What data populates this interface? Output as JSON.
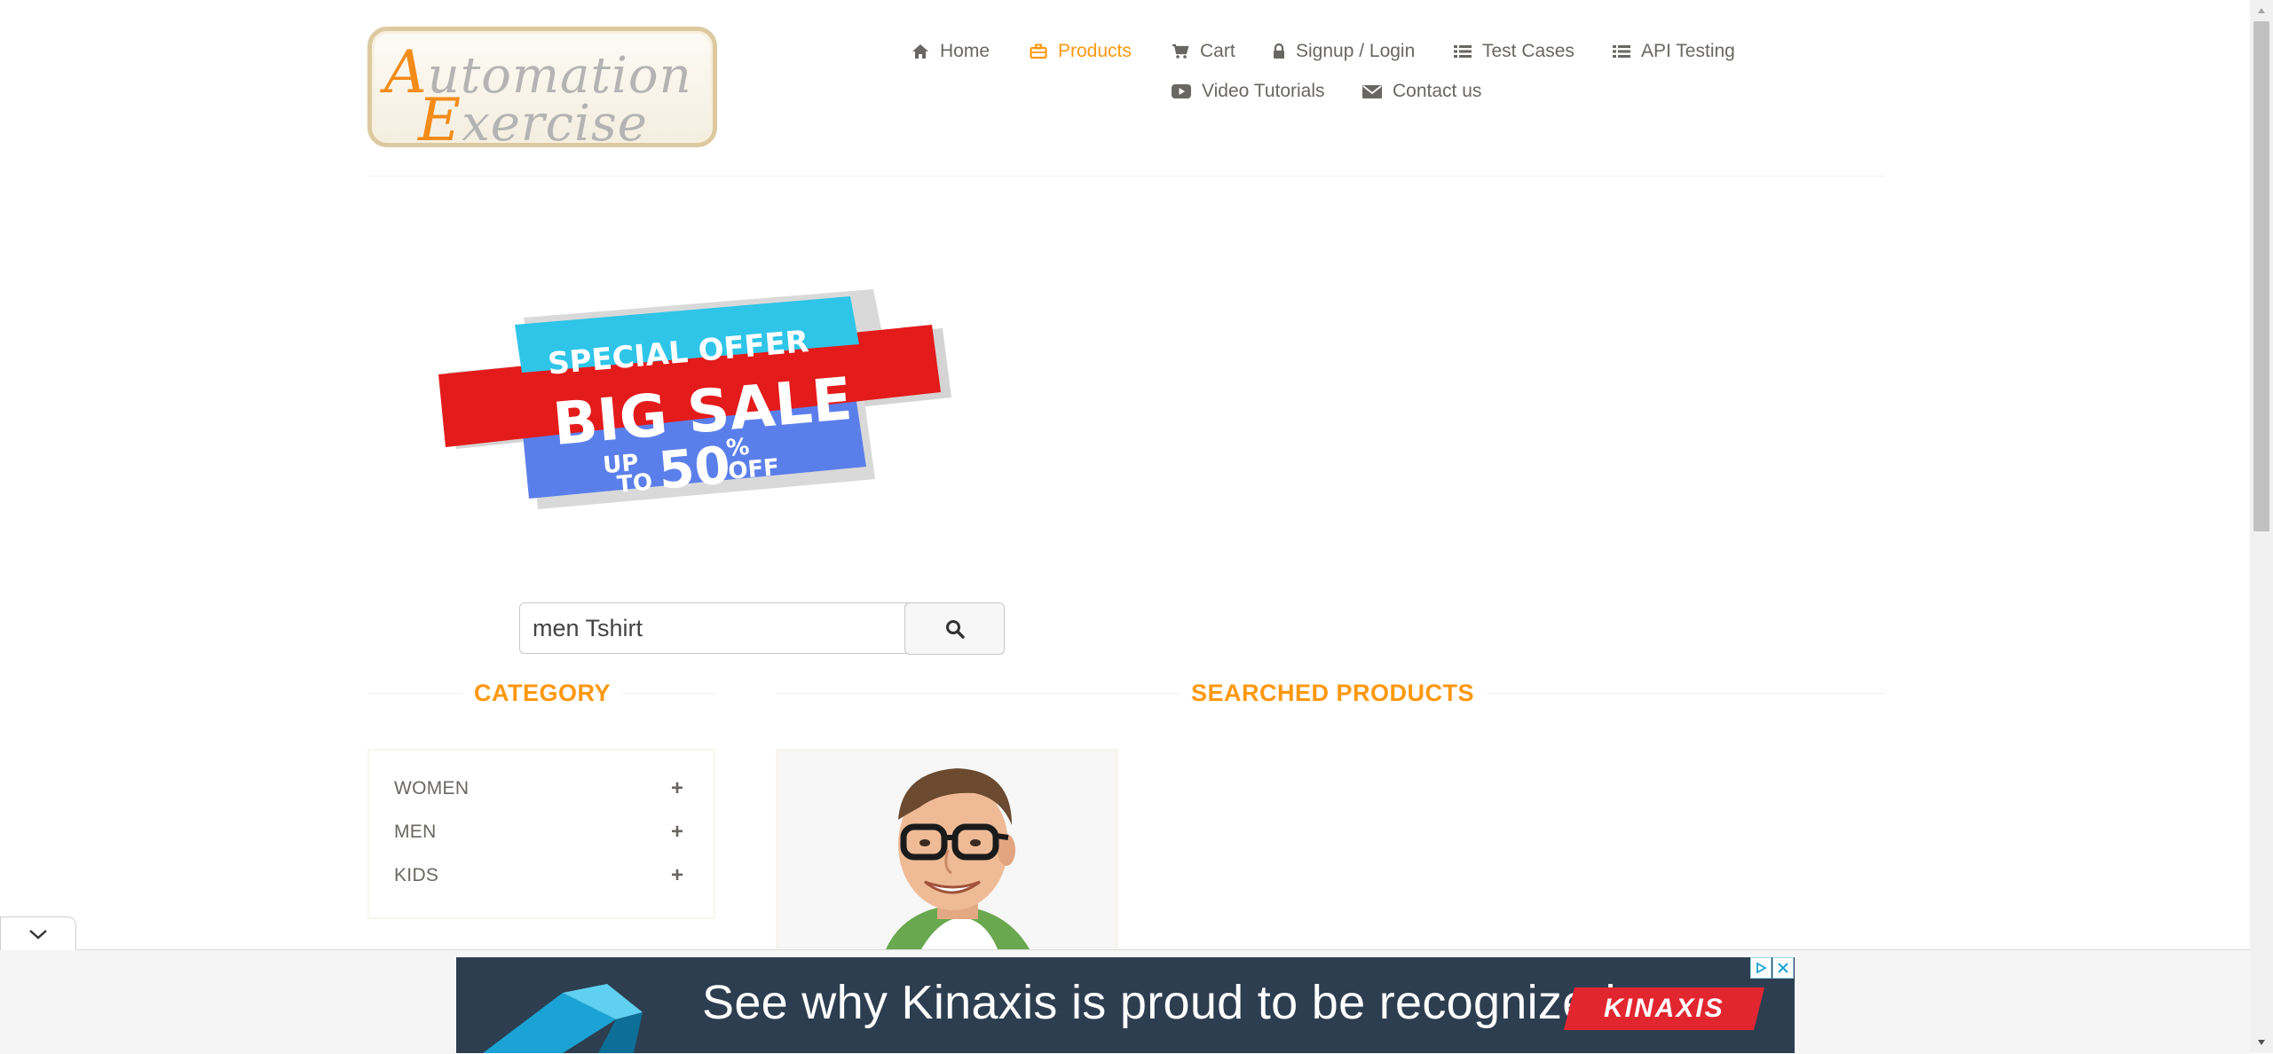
{
  "logo": {
    "line1_initial": "A",
    "line1_rest": "utomation",
    "line2_initial": "E",
    "line2_rest": "xercise"
  },
  "nav": {
    "home": "Home",
    "products": "Products",
    "cart": "Cart",
    "signup_login": "Signup / Login",
    "test_cases": "Test Cases",
    "api_testing": "API Testing",
    "video_tutorials": "Video Tutorials",
    "contact_us": "Contact us",
    "active_item": "Products",
    "active_color": "#fe980f"
  },
  "banner": {
    "top": "SPECIAL OFFER",
    "middle": "BIG SALE",
    "up": "UP",
    "to": "TO",
    "amount": "50",
    "percent": "%",
    "off": "OFF",
    "colors": {
      "cyan": "#2ec5e8",
      "red": "#e41b1b",
      "blue": "#5b7fea"
    }
  },
  "search": {
    "value": "men Tshirt",
    "button_icon": "search-icon"
  },
  "sidebar": {
    "title": "CATEGORY",
    "categories": [
      {
        "label": "WOMEN",
        "toggle": "+"
      },
      {
        "label": "MEN",
        "toggle": "+"
      },
      {
        "label": "KIDS",
        "toggle": "+"
      }
    ]
  },
  "main": {
    "title": "SEARCHED PRODUCTS"
  },
  "ad": {
    "text": "See why Kinaxis is proud to be recognized",
    "brand": "KINAXIS",
    "adchoices_icon": "adchoices-icon",
    "close_icon": "close-icon"
  },
  "collapse_icon": "chevron-down-icon",
  "theme": {
    "accent": "#fe980f",
    "text": "#696763"
  }
}
